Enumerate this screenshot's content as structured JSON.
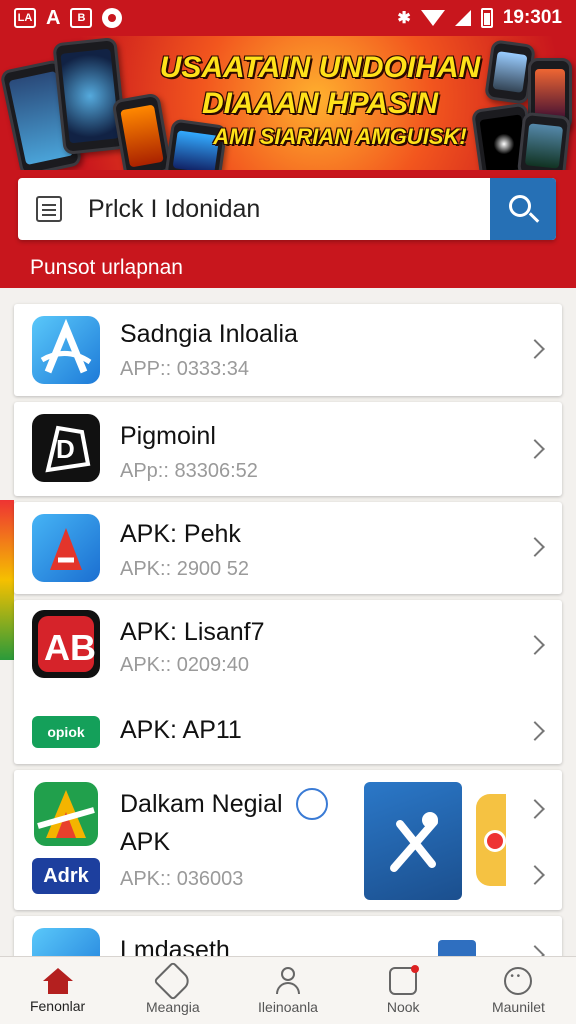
{
  "status_bar": {
    "left_icons": [
      "LA",
      "A",
      "B"
    ],
    "time": "19:301"
  },
  "banner": {
    "line1": "USAATAIN UNDOIHAN",
    "line2": "DIAAAN HPASIN",
    "line3": "AMI SIARIAN AMGUISK!"
  },
  "search": {
    "value": "Prlck I Idonidan",
    "section_label": "Punsot urlapnan"
  },
  "apps": [
    {
      "title": "Sadngia Inloalia",
      "subtitle": "APP:: 0333:34",
      "icon": "blue-a-icon"
    },
    {
      "title": "Pigmoinl",
      "subtitle": "APp:: 83306:52",
      "icon": "black-d-icon"
    },
    {
      "title": "APK: Pehk",
      "subtitle": "APK:: 2900 52",
      "icon": "red-a-icon"
    },
    {
      "title": "APK: Lisanf7",
      "subtitle": "APK:: 0209:40",
      "icon": "red-ab-icon"
    },
    {
      "title": "APK: AP11",
      "subtitle": "",
      "icon": "green-opiok-icon",
      "icon_text": "opiok"
    },
    {
      "title": "Dalkam Negial",
      "title2": "APK",
      "subtitle": "APK:: 036003",
      "icon": "google-a-icon",
      "icon_text": "Adrk"
    },
    {
      "title": "Lmdaseth",
      "subtitle": "",
      "icon": "blue-partial-icon"
    }
  ],
  "bottom_nav": [
    {
      "label": "Fenonlar",
      "icon": "home-icon"
    },
    {
      "label": "Meangia",
      "icon": "tag-icon"
    },
    {
      "label": "Ileinoanla",
      "icon": "person-icon"
    },
    {
      "label": "Nook",
      "icon": "chat-icon"
    },
    {
      "label": "Maunilet",
      "icon": "smile-icon"
    }
  ]
}
